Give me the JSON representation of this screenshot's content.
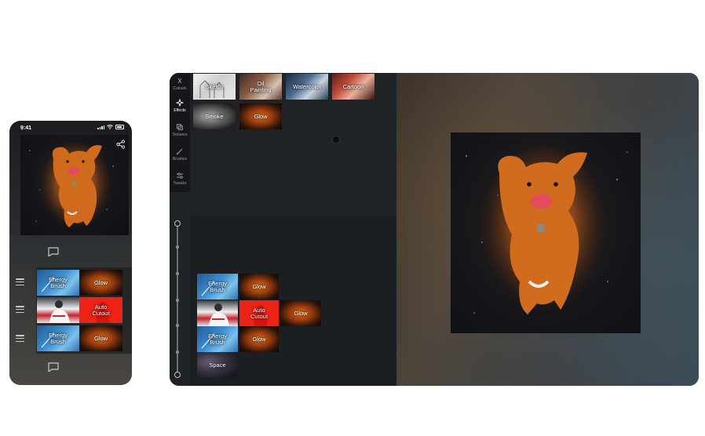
{
  "phone": {
    "status_time": "9:41",
    "rows": [
      {
        "tiles": [
          {
            "name": "energy-brush-tile",
            "label": "Energy\nBrush",
            "bg": "energy"
          },
          {
            "name": "glow-tile",
            "label": "Glow",
            "bg": "glow"
          }
        ]
      },
      {
        "tiles": [
          {
            "name": "photo-tile",
            "label": "",
            "bg": "player"
          },
          {
            "name": "auto-cutout-tile",
            "label": "Auto\nCutout",
            "bg": "cutout"
          }
        ]
      },
      {
        "tiles": [
          {
            "name": "energy-brush-tile",
            "label": "Energy\nBrush",
            "bg": "energy"
          },
          {
            "name": "glow-tile",
            "label": "Glow",
            "bg": "glow"
          }
        ]
      }
    ]
  },
  "sidebar": {
    "items": [
      {
        "label": "Cutouts",
        "icon": "cutouts-icon"
      },
      {
        "label": "Effects",
        "icon": "effects-icon"
      },
      {
        "label": "Textures",
        "icon": "textures-icon"
      },
      {
        "label": "Brushes",
        "icon": "brushes-icon"
      },
      {
        "label": "Tweaks",
        "icon": "tweaks-icon"
      }
    ],
    "active": "Effects"
  },
  "effects": {
    "row1": [
      {
        "label": "Sketch",
        "bg": "sketch"
      },
      {
        "label": "Oil\nPainting",
        "bg": "oil"
      },
      {
        "label": "Watercolor",
        "bg": "water"
      },
      {
        "label": "Cartoon",
        "bg": "cartoon"
      }
    ],
    "row2": [
      {
        "label": "Smoke",
        "bg": "smoke"
      },
      {
        "label": "Glow",
        "bg": "glow"
      }
    ]
  },
  "layers": [
    [
      {
        "label": "Energy\nBrush",
        "bg": "energy"
      },
      {
        "label": "Glow",
        "bg": "glow"
      }
    ],
    [
      {
        "label": "",
        "bg": "player"
      },
      {
        "label": "Auto\nCutout",
        "bg": "cutout"
      },
      {
        "label": "Glow",
        "bg": "glow"
      }
    ],
    [
      {
        "label": "Energy\nBrush",
        "bg": "energy"
      },
      {
        "label": "Glow",
        "bg": "glow"
      }
    ],
    [
      {
        "label": "Space",
        "bg": "space"
      }
    ]
  ]
}
